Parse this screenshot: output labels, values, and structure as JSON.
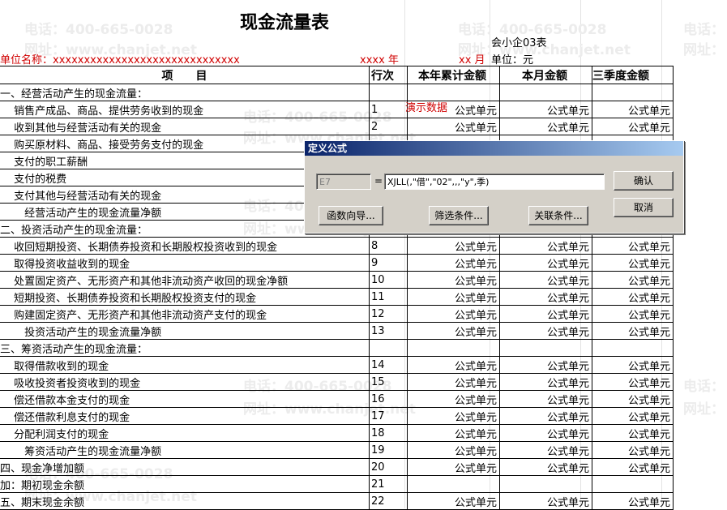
{
  "watermark": {
    "phone": "电话：400-665-0028",
    "site": "网址：www.chanjet.net",
    "phone_short": "电话：",
    "site_short": "网址："
  },
  "report": {
    "title": "现金流量表",
    "form_code": "会小企03表",
    "unit_name_label": "单位名称：xxxxxxxxxxxxxxxxxxxxxxxxxxxxxx",
    "year_label": "xxxx 年",
    "month_label": "xx 月",
    "currency_label": "单位：元",
    "demo_data_label": "演示数据"
  },
  "columns": {
    "item": "项　　目",
    "line_no": "行次",
    "ytd": "本年累计金额",
    "month": "本月金额",
    "quarter": "三季度金额"
  },
  "rows": [
    {
      "item": "一、经营活动产生的现金流量：",
      "ln": "",
      "ytd": "",
      "month": "",
      "quarter": ""
    },
    {
      "item": "　 销售产成品、商品、提供劳务收到的现金",
      "ln": "1",
      "ytd": "公式单元",
      "month": "公式单元",
      "quarter": "公式单元"
    },
    {
      "item": "　 收到其他与经营活动有关的现金",
      "ln": "2",
      "ytd": "公式单元",
      "month": "公式单元",
      "quarter": "公式单元"
    },
    {
      "item": "　 购买原材料、商品、接受劳务支付的现金",
      "ln": "",
      "ytd": "",
      "month": "",
      "quarter": ""
    },
    {
      "item": "　 支付的职工薪酬",
      "ln": "",
      "ytd": "",
      "month": "",
      "quarter": ""
    },
    {
      "item": "　 支付的税费",
      "ln": "",
      "ytd": "",
      "month": "",
      "quarter": ""
    },
    {
      "item": "　 支付其他与经营活动有关的现金",
      "ln": "",
      "ytd": "",
      "month": "",
      "quarter": ""
    },
    {
      "item": "　　 经营活动产生的现金流量净额",
      "ln": "",
      "ytd": "",
      "month": "",
      "quarter": ""
    },
    {
      "item": "二、投资活动产生的现金流量：",
      "ln": "",
      "ytd": "",
      "month": "",
      "quarter": ""
    },
    {
      "item": "　 收回短期投资、长期债券投资和长期股权投资收到的现金",
      "ln": "8",
      "ytd": "公式单元",
      "month": "公式单元",
      "quarter": "公式单元"
    },
    {
      "item": "　 取得投资收益收到的现金",
      "ln": "9",
      "ytd": "公式单元",
      "month": "公式单元",
      "quarter": "公式单元"
    },
    {
      "item": "　 处置固定资产、无形资产和其他非流动资产收回的现金净额",
      "ln": "10",
      "ytd": "公式单元",
      "month": "公式单元",
      "quarter": "公式单元"
    },
    {
      "item": "　 短期投资、长期债券投资和长期股权投资支付的现金",
      "ln": "11",
      "ytd": "公式单元",
      "month": "公式单元",
      "quarter": "公式单元"
    },
    {
      "item": "　 购建固定资产、无形资产和其他非流动资产支付的现金",
      "ln": "12",
      "ytd": "公式单元",
      "month": "公式单元",
      "quarter": "公式单元"
    },
    {
      "item": "　　 投资活动产生的现金流量净额",
      "ln": "13",
      "ytd": "公式单元",
      "month": "公式单元",
      "quarter": "公式单元"
    },
    {
      "item": "三、筹资活动产生的现金流量：",
      "ln": "",
      "ytd": "",
      "month": "",
      "quarter": ""
    },
    {
      "item": "　 取得借款收到的现金",
      "ln": "14",
      "ytd": "公式单元",
      "month": "公式单元",
      "quarter": "公式单元"
    },
    {
      "item": "　 吸收投资者投资收到的现金",
      "ln": "15",
      "ytd": "公式单元",
      "month": "公式单元",
      "quarter": "公式单元"
    },
    {
      "item": "　 偿还借款本金支付的现金",
      "ln": "16",
      "ytd": "公式单元",
      "month": "公式单元",
      "quarter": "公式单元"
    },
    {
      "item": "　 偿还借款利息支付的现金",
      "ln": "17",
      "ytd": "公式单元",
      "month": "公式单元",
      "quarter": "公式单元"
    },
    {
      "item": "　 分配利润支付的现金",
      "ln": "18",
      "ytd": "公式单元",
      "month": "公式单元",
      "quarter": "公式单元"
    },
    {
      "item": "　　 筹资活动产生的现金流量净额",
      "ln": "19",
      "ytd": "公式单元",
      "month": "公式单元",
      "quarter": "公式单元"
    },
    {
      "item": "四、现金净增加额",
      "ln": "20",
      "ytd": "公式单元",
      "month": "公式单元",
      "quarter": "公式单元"
    },
    {
      "item": "加：期初现金余额",
      "ln": "21",
      "ytd": "",
      "month": "",
      "quarter": ""
    },
    {
      "item": "五、期末现金余额",
      "ln": "22",
      "ytd": "公式单元",
      "month": "公式单元",
      "quarter": "公式单元"
    }
  ],
  "dialog": {
    "title": "定义公式",
    "cell_ref": "E7",
    "equals": "=",
    "formula": "XJLL(,\"借\",\"02\",,,\"y\",季)",
    "ok_label": "确认",
    "cancel_label": "取消",
    "func_wizard_label": "函数向导...",
    "filter_label": "筛选条件...",
    "link_label": "关联条件..."
  },
  "colors": {
    "red_text": "#d00000",
    "dialog_bg": "#d4d0c8",
    "title_bar": "#0a246a"
  }
}
